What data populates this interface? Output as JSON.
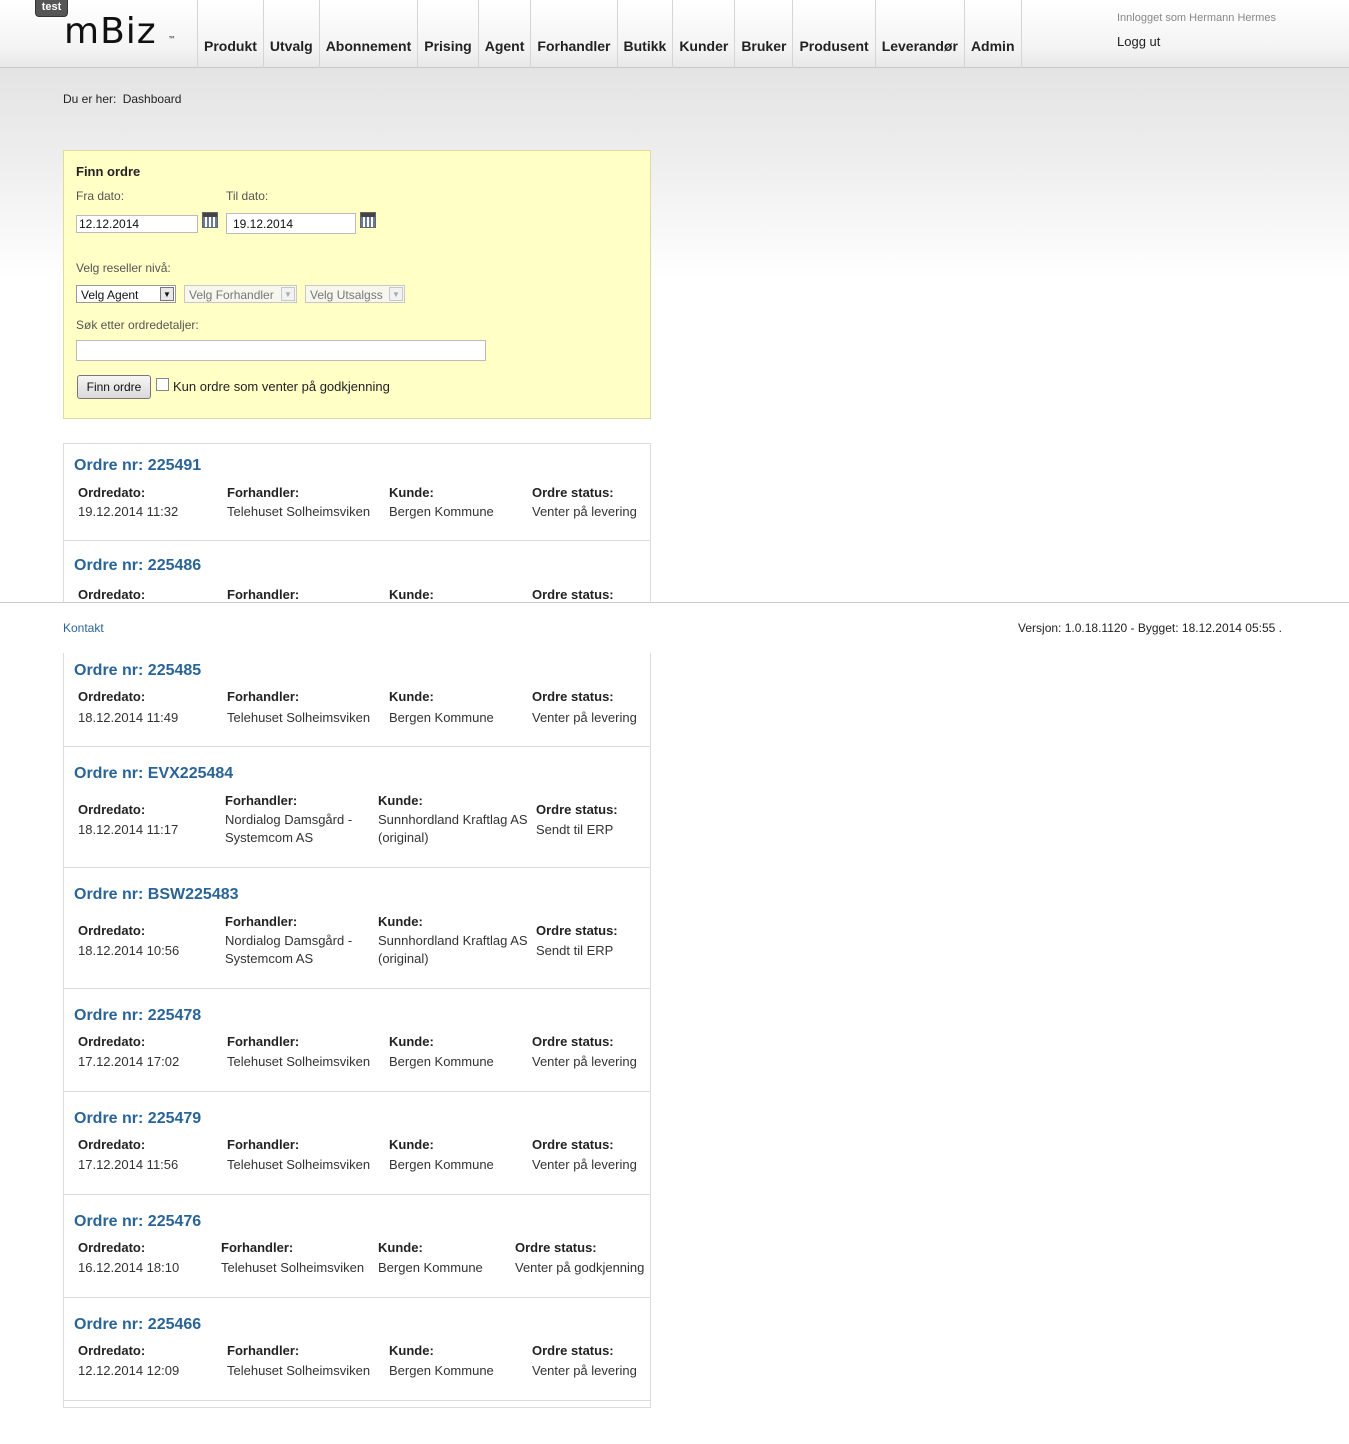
{
  "header": {
    "env_badge": "test",
    "logo": "mBiz",
    "logo_tm": "™",
    "nav": [
      "Produkt",
      "Utvalg",
      "Abonnement",
      "Prising",
      "Agent",
      "Forhandler",
      "Butikk",
      "Kunder",
      "Bruker",
      "Produsent",
      "Leverandør",
      "Admin"
    ],
    "logged_in_as": "Innlogget som Hermann Hermes",
    "logout": "Logg ut"
  },
  "breadcrumb": {
    "prefix": "Du er her:",
    "current": "Dashboard"
  },
  "search": {
    "title": "Finn ordre",
    "from_label": "Fra dato:",
    "from_value": "12.12.2014",
    "to_label": "Til dato:",
    "to_value": "19.12.2014",
    "reseller_label": "Velg reseller nivå:",
    "agent_select": "Velg Agent",
    "dealer_select": "Velg Forhandler",
    "outlet_select": "Velg Utsalgss",
    "details_label": "Søk etter ordredetaljer:",
    "details_value": "",
    "button": "Finn ordre",
    "pending_label": "Kun ordre som venter på godkjenning",
    "pending_checked": false
  },
  "labels": {
    "date": "Ordredato:",
    "dealer": "Forhandler:",
    "customer": "Kunde:",
    "status": "Ordre status:"
  },
  "orders": [
    {
      "title": "Ordre nr: 225491",
      "date": "19.12.2014 11:32",
      "dealer": "Telehuset Solheimsviken",
      "customer": "Bergen Kommune",
      "status": "Venter på levering"
    },
    {
      "title": "Ordre nr: 225486",
      "date": "",
      "dealer": "",
      "customer": "",
      "status": ""
    },
    {
      "title": "Ordre nr: 225485",
      "date": "18.12.2014 11:49",
      "dealer": "Telehuset Solheimsviken",
      "customer": "Bergen Kommune",
      "status": "Venter på levering"
    },
    {
      "title": "Ordre nr: EVX225484",
      "date": "18.12.2014 11:17",
      "dealer": "Nordialog Damsgård - Systemcom AS",
      "customer": "Sunnhordland Kraftlag AS (original)",
      "status": "Sendt til ERP"
    },
    {
      "title": "Ordre nr: BSW225483",
      "date": "18.12.2014 10:56",
      "dealer": "Nordialog Damsgård - Systemcom AS",
      "customer": "Sunnhordland Kraftlag AS (original)",
      "status": "Sendt til ERP"
    },
    {
      "title": "Ordre nr: 225478",
      "date": "17.12.2014 17:02",
      "dealer": "Telehuset Solheimsviken",
      "customer": "Bergen Kommune",
      "status": "Venter på levering"
    },
    {
      "title": "Ordre nr: 225479",
      "date": "17.12.2014 11:56",
      "dealer": "Telehuset Solheimsviken",
      "customer": "Bergen Kommune",
      "status": "Venter på levering"
    },
    {
      "title": "Ordre nr: 225476",
      "date": "16.12.2014 18:10",
      "dealer": "Telehuset Solheimsviken",
      "customer": "Bergen Kommune",
      "status": "Venter på godkjenning"
    },
    {
      "title": "Ordre nr: 225466",
      "date": "12.12.2014 12:09",
      "dealer": "Telehuset Solheimsviken",
      "customer": "Bergen Kommune",
      "status": "Venter på levering"
    }
  ],
  "footer": {
    "contact": "Kontakt",
    "version": "Versjon: 1.0.18.1120 - Bygget: 18.12.2014 05:55 ."
  },
  "colors": {
    "order_title": "#2a6496",
    "search_panel_bg": "#ffffc6"
  }
}
